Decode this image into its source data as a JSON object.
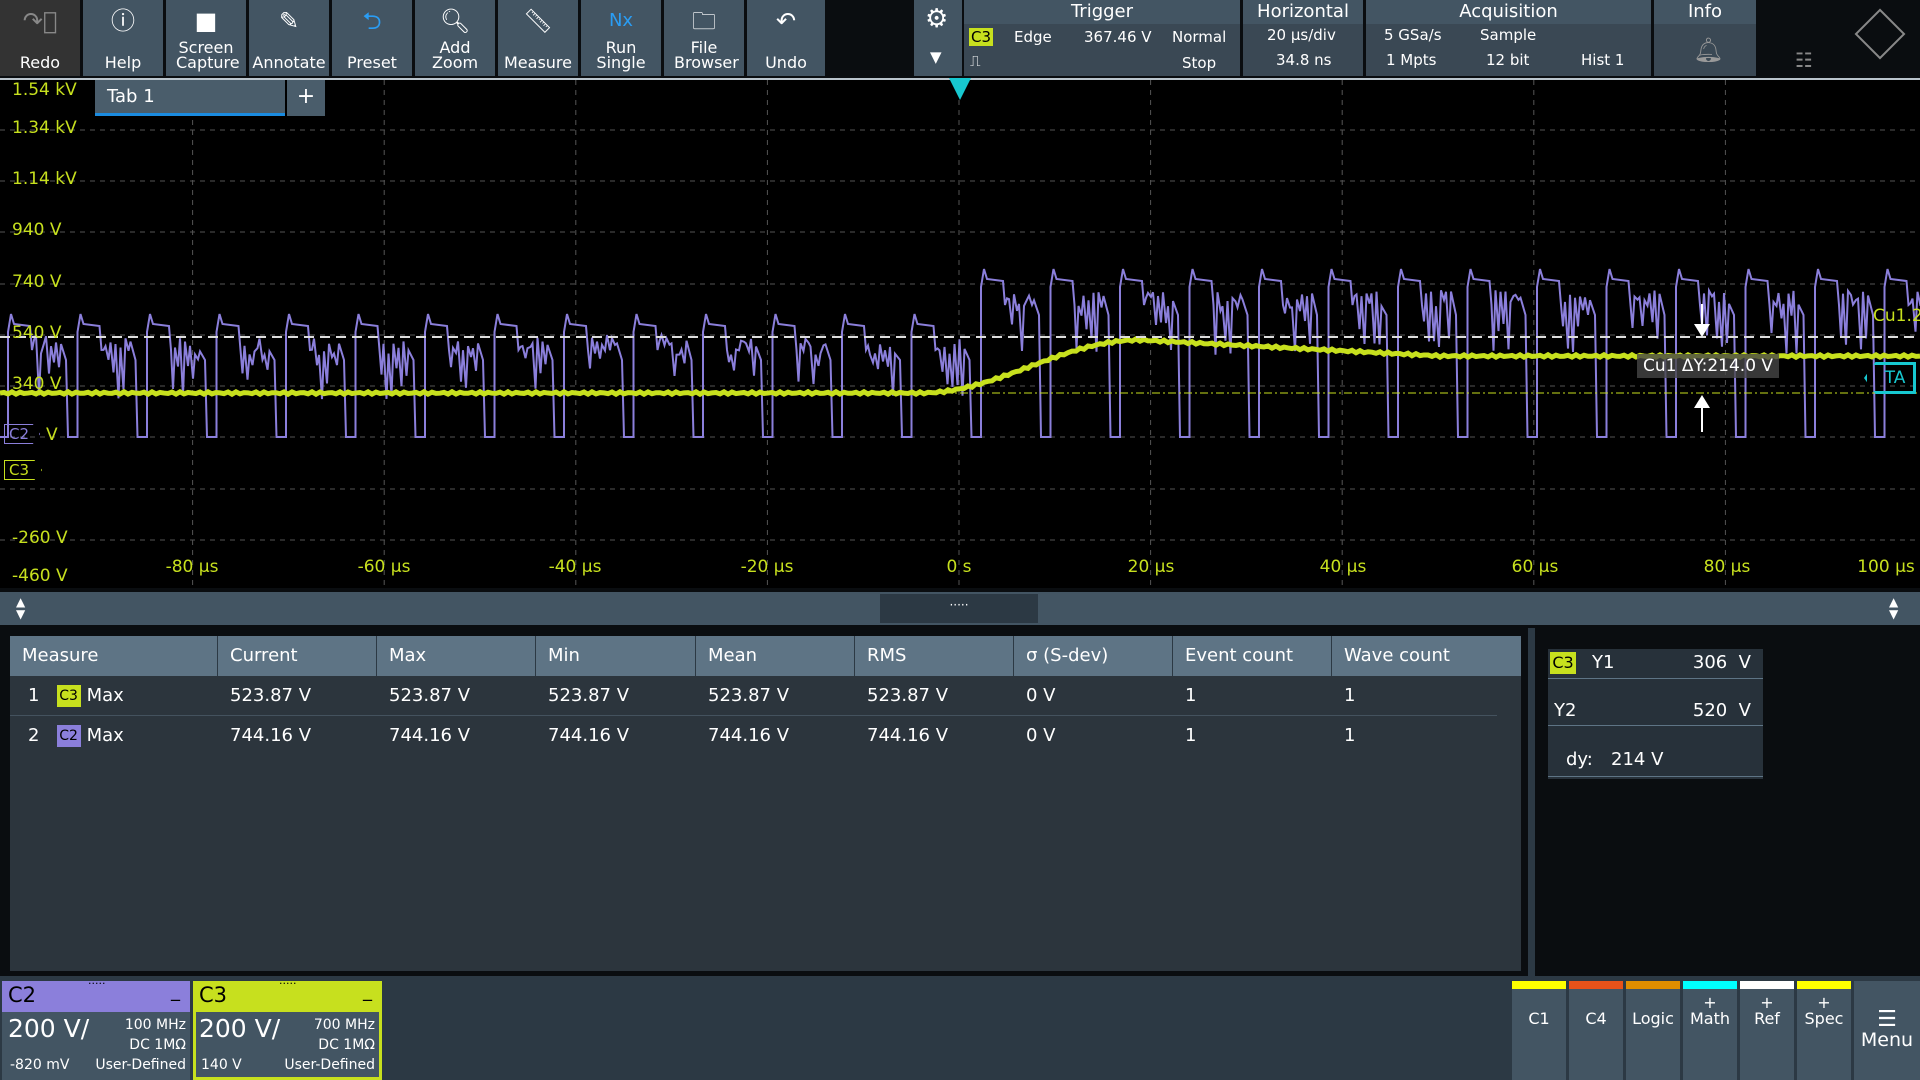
{
  "toolbar": {
    "buttons": [
      {
        "label": "Redo",
        "icon": "redo-icon"
      },
      {
        "label": "Help",
        "icon": "help-icon"
      },
      {
        "label": "Screen Capture",
        "icon": "camera-icon"
      },
      {
        "label": "Annotate",
        "icon": "pencil-icon"
      },
      {
        "label": "Preset",
        "icon": "preset-icon"
      },
      {
        "label": "Add Zoom",
        "icon": "zoom-icon"
      },
      {
        "label": "Measure",
        "icon": "ruler-icon"
      },
      {
        "label": "Run Single",
        "icon": "run-single-icon"
      },
      {
        "label": "File Browser",
        "icon": "folder-search-icon"
      },
      {
        "label": "Undo",
        "icon": "undo-icon"
      }
    ]
  },
  "trigger": {
    "title": "Trigger",
    "source": "C3",
    "type": "Edge",
    "level": "367.46 V",
    "mode": "Normal",
    "state": "Stop"
  },
  "horizontal": {
    "title": "Horizontal",
    "scale": "20 µs/div",
    "position": "34.8 ns"
  },
  "acquisition": {
    "title": "Acquisition",
    "rate": "5 GSa/s",
    "mode": "Sample",
    "points": "1 Mpts",
    "resolution": "12 bit",
    "hist": "Hist 1"
  },
  "info": {
    "title": "Info"
  },
  "tabs": {
    "tab1": "Tab 1",
    "add": "+"
  },
  "plot": {
    "y_labels": [
      "1.54 kV",
      "1.34 kV",
      "1.14 kV",
      "940 V",
      "740 V",
      "540 V",
      "340 V",
      "V",
      "-260 V",
      "-460 V"
    ],
    "x_labels": [
      "-80 µs",
      "-60 µs",
      "-40 µs",
      "-20 µs",
      "0 s",
      "20 µs",
      "40 µs",
      "60 µs",
      "80 µs",
      "100 µs"
    ],
    "c2_marker": "C2",
    "c3_marker": "C3",
    "cursor_label": "Cu1 ΔY:214.0 V",
    "cursor_name": "Cu1.2",
    "trigger_marker": "TA",
    "colors": {
      "c2": "#8b7fdb",
      "c3": "#c7e01e",
      "trigger": "#17c8d0"
    }
  },
  "divider": {
    "handle": "·····"
  },
  "measure_table": {
    "headers": [
      "Measure",
      "Current",
      "Max",
      "Min",
      "Mean",
      "RMS",
      "σ (S-dev)",
      "Event count",
      "Wave count"
    ],
    "rows": [
      {
        "index": "1",
        "channel": "C3",
        "name": "Max",
        "values": [
          "523.87 V",
          "523.87 V",
          "523.87 V",
          "523.87 V",
          "523.87 V",
          "0 V",
          "1",
          "1"
        ]
      },
      {
        "index": "2",
        "channel": "C2",
        "name": "Max",
        "values": [
          "744.16 V",
          "744.16 V",
          "744.16 V",
          "744.16 V",
          "744.16 V",
          "0 V",
          "1",
          "1"
        ]
      }
    ]
  },
  "cursor_panel": {
    "channel": "C3",
    "y1_label": "Y1",
    "y1": "306  V",
    "y2_label": "Y2",
    "y2": "520  V",
    "dy_label": "dy:",
    "dy": "214 V"
  },
  "channels": [
    {
      "name": "C2",
      "scale": "200",
      "unit": "V/",
      "bandwidth": "100 MHz",
      "coupling": "DC 1MΩ",
      "offset": "-820 mV",
      "probe": "User-Defined",
      "color": "#8b7fdb",
      "min": "_",
      "handle": "·····"
    },
    {
      "name": "C3",
      "scale": "200",
      "unit": "V/",
      "bandwidth": "700 MHz",
      "coupling": "DC 1MΩ",
      "offset": "140 V",
      "probe": "User-Defined",
      "color": "#c7e01e",
      "min": "_",
      "handle": "·····"
    }
  ],
  "bottom_buttons": [
    {
      "plus": "",
      "label": "C1",
      "color": "#ffff00"
    },
    {
      "plus": "",
      "label": "C4",
      "color": "#e6521a"
    },
    {
      "plus": "",
      "label": "Logic",
      "color": "#e08e00"
    },
    {
      "plus": "+",
      "label": "Math",
      "color": "#00ffff"
    },
    {
      "plus": "+",
      "label": "Ref",
      "color": "#ffffff"
    },
    {
      "plus": "+",
      "label": "Spec",
      "color": "#ffff00"
    }
  ],
  "menu": {
    "label": "Menu"
  }
}
